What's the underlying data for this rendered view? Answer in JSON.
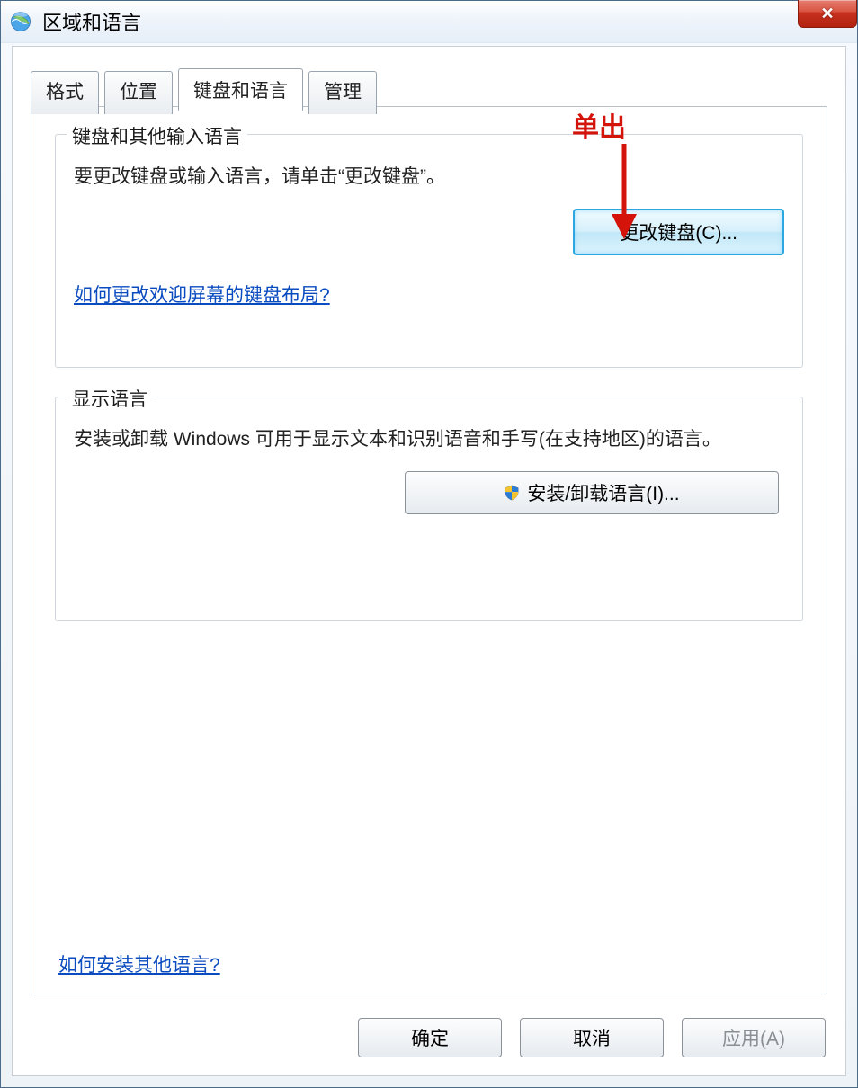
{
  "window": {
    "title": "区域和语言"
  },
  "tabs": {
    "format": "格式",
    "location": "位置",
    "keyboard_lang": "键盘和语言",
    "admin": "管理"
  },
  "section_keyboard": {
    "legend": "键盘和其他输入语言",
    "desc": "要更改键盘或输入语言，请单击“更改键盘”。",
    "change_btn": "更改键盘(C)...",
    "link": "如何更改欢迎屏幕的键盘布局?"
  },
  "section_display": {
    "legend": "显示语言",
    "desc": "安装或卸载 Windows 可用于显示文本和识别语音和手写(在支持地区)的语言。",
    "install_btn": "安装/卸载语言(I)..."
  },
  "bottom_link": "如何安装其他语言?",
  "buttons": {
    "ok": "确定",
    "cancel": "取消",
    "apply": "应用(A)"
  },
  "annotation": {
    "label": "单出"
  }
}
